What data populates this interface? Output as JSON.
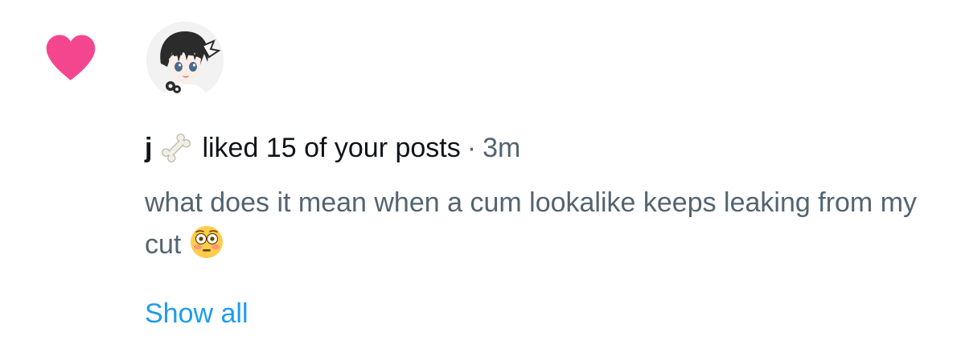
{
  "notification": {
    "type_icon": "heart-icon",
    "heart_color": "#f4468f",
    "avatar": "user-avatar-anime",
    "username": "j",
    "username_emoji": "bone-emoji",
    "action": "liked 15 of your posts",
    "separator": "·",
    "timestamp": "3m",
    "post_text": "what does it mean when a cum lookalike keeps leaking from my cut",
    "post_emoji": "flushed-face-emoji",
    "show_all_label": "Show all"
  },
  "colors": {
    "primary_text": "#0f1419",
    "secondary_text": "#536471",
    "link": "#1d9bf0",
    "heart": "#f4468f"
  }
}
